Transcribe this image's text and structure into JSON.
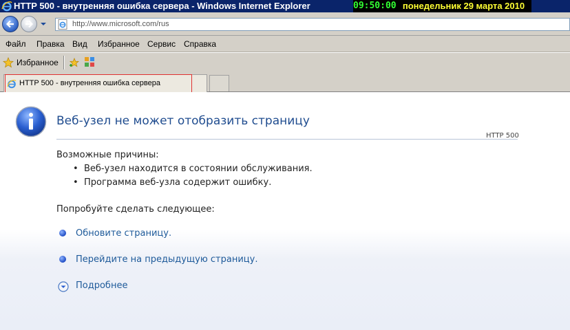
{
  "window": {
    "title": "HTTP 500 - внутренняя ошибка сервера - Windows Internet Explorer",
    "clock": "09:50:00",
    "date": "понедельник 29 марта 2010"
  },
  "address": {
    "url": "http://www.microsoft.com/rus"
  },
  "menu": {
    "file": "Файл",
    "edit": "Правка",
    "view": "Вид",
    "favorites": "Избранное",
    "tools": "Сервис",
    "help": "Справка"
  },
  "favbar": {
    "label": "Избранное"
  },
  "tab": {
    "label": "HTTP 500 - внутренняя ошибка сервера"
  },
  "page": {
    "title": "Веб-узел не может отобразить страницу",
    "code": "HTTP 500",
    "causes_heading": "Возможные причины:",
    "causes": [
      "Веб-узел находится в состоянии обслуживания.",
      "Программа веб-узла содержит ошибку."
    ],
    "try_heading": "Попробуйте сделать следующее:",
    "actions": {
      "refresh": "Обновите страницу.",
      "back": "Перейдите на предыдущую страницу.",
      "more": "Подробнее"
    }
  },
  "colors": {
    "title_bar": "#0a246a",
    "clock_text": "#33ff33",
    "date_text": "#ffff33",
    "heading": "#1f4c8f",
    "link": "#1e5a9a",
    "tab_highlight": "#e03030"
  },
  "icons": {
    "window": "ie-logo-icon",
    "back": "back-arrow-icon",
    "forward": "forward-arrow-icon",
    "page": "ie-page-icon",
    "favorites": "favorites-star-icon",
    "add_favorite": "add-favorite-icon",
    "feeds": "web-slice-gallery-icon",
    "info": "info-icon",
    "expand": "expand-chevron-icon"
  }
}
